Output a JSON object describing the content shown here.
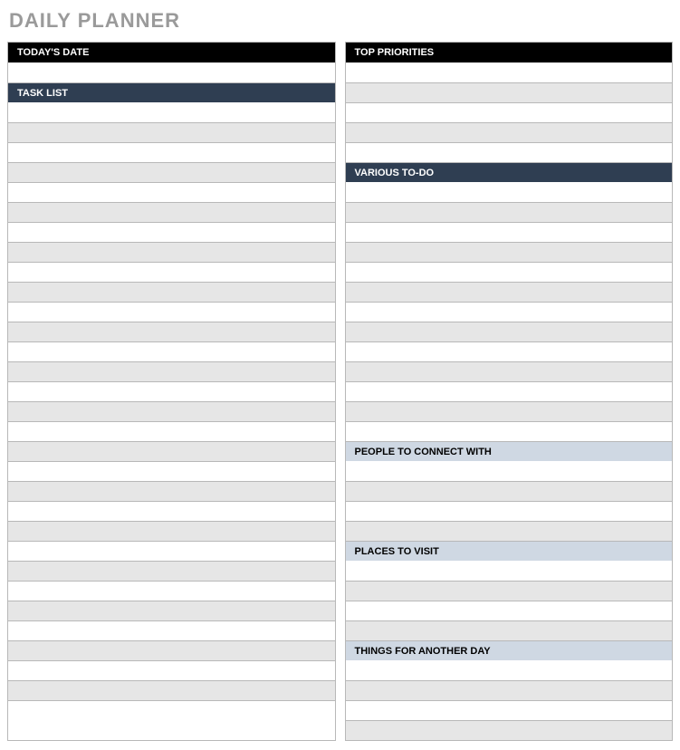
{
  "page_title": "DAILY PLANNER",
  "left": {
    "date_header": "TODAY'S DATE",
    "date_value": "",
    "task_header": "TASK LIST",
    "task_rows": [
      "",
      "",
      "",
      "",
      "",
      "",
      "",
      "",
      "",
      "",
      "",
      "",
      "",
      "",
      "",
      "",
      "",
      "",
      "",
      "",
      "",
      "",
      "",
      "",
      "",
      "",
      "",
      "",
      "",
      "",
      ""
    ]
  },
  "right": {
    "priorities_header": "TOP PRIORITIES",
    "priorities_rows": [
      "",
      "",
      "",
      "",
      ""
    ],
    "todo_header": "VARIOUS TO-DO",
    "todo_rows": [
      "",
      "",
      "",
      "",
      "",
      "",
      "",
      "",
      "",
      "",
      "",
      "",
      ""
    ],
    "people_header": "PEOPLE TO CONNECT WITH",
    "people_rows": [
      "",
      "",
      "",
      ""
    ],
    "places_header": "PLACES TO VISIT",
    "places_rows": [
      "",
      "",
      "",
      ""
    ],
    "another_header": "THINGS FOR ANOTHER DAY",
    "another_rows": [
      "",
      "",
      "",
      ""
    ]
  }
}
